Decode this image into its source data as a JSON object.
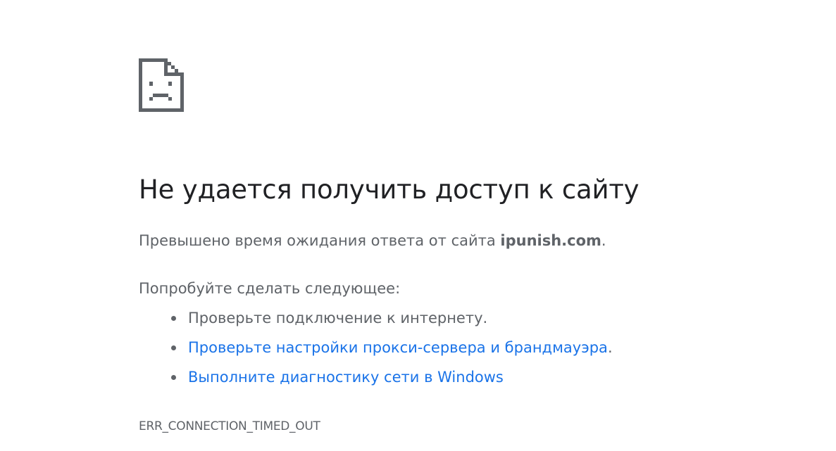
{
  "error_page": {
    "icon": "sad-page-icon",
    "title": "Не удается получить доступ к сайту",
    "summary_prefix": "Превышено время ожидания ответа от сайта ",
    "host": "ipunish.com",
    "summary_suffix": ".",
    "suggestions_heading": "Попробуйте сделать следующее:",
    "suggestions": [
      {
        "text": "Проверьте подключение к интернету.",
        "link": false
      },
      {
        "text": "Проверьте настройки прокси-сервера и брандмауэра",
        "link": true,
        "suffix": "."
      },
      {
        "text": "Выполните диагностику сети в Windows",
        "link": true,
        "suffix": ""
      }
    ],
    "error_code": "ERR_CONNECTION_TIMED_OUT"
  },
  "colors": {
    "title": "#202124",
    "body_text": "#5f6368",
    "link": "#1a73e8",
    "icon": "#5f6368"
  }
}
